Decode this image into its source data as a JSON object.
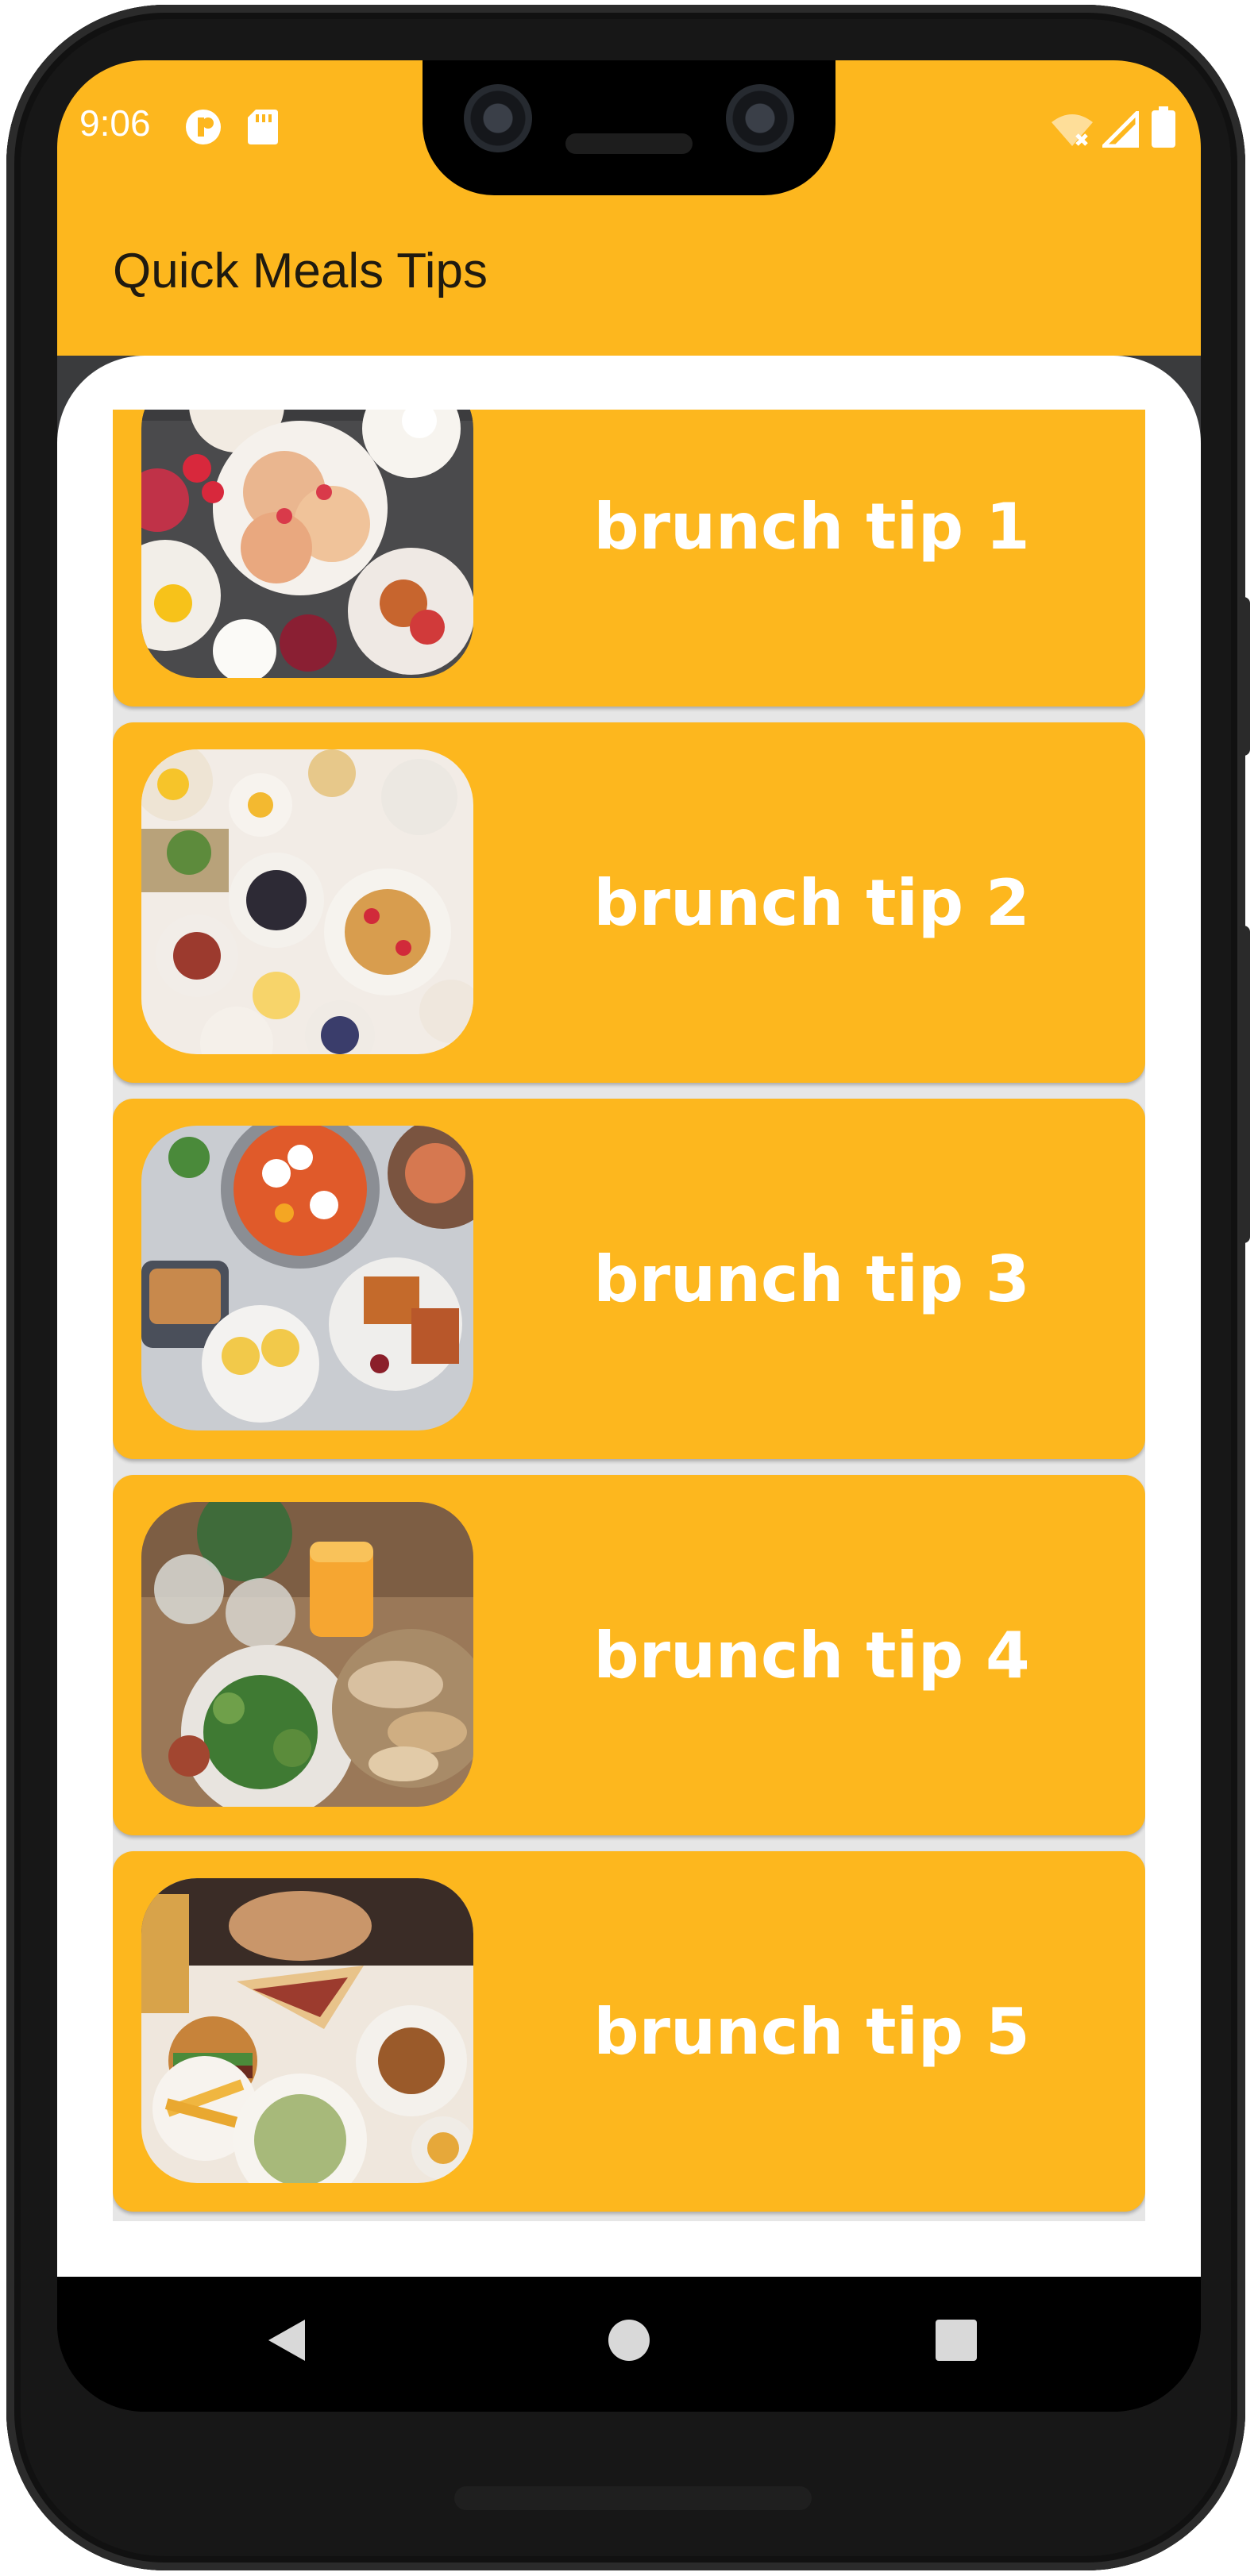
{
  "status_bar": {
    "time": "9:06",
    "icons": [
      "app-notification-icon",
      "sd-card-icon",
      "wifi-off-icon",
      "signal-icon",
      "battery-icon"
    ]
  },
  "app_bar": {
    "title": "Quick Meals Tips"
  },
  "colors": {
    "accent": "#FDB71E",
    "card_text": "#FFFFFF",
    "title_text": "#1F1A10"
  },
  "tips": [
    {
      "label": "brunch tip 1",
      "image": "brunch-pancakes-photo"
    },
    {
      "label": "brunch tip 2",
      "image": "brunch-waffles-photo"
    },
    {
      "label": "brunch tip 3",
      "image": "brunch-shakshuka-photo"
    },
    {
      "label": "brunch tip 4",
      "image": "brunch-bread-salad-photo"
    },
    {
      "label": "brunch tip 5",
      "image": "brunch-sandwich-fries-photo"
    }
  ],
  "nav_bar": {
    "icons": [
      "back-icon",
      "home-icon",
      "recents-icon"
    ]
  }
}
